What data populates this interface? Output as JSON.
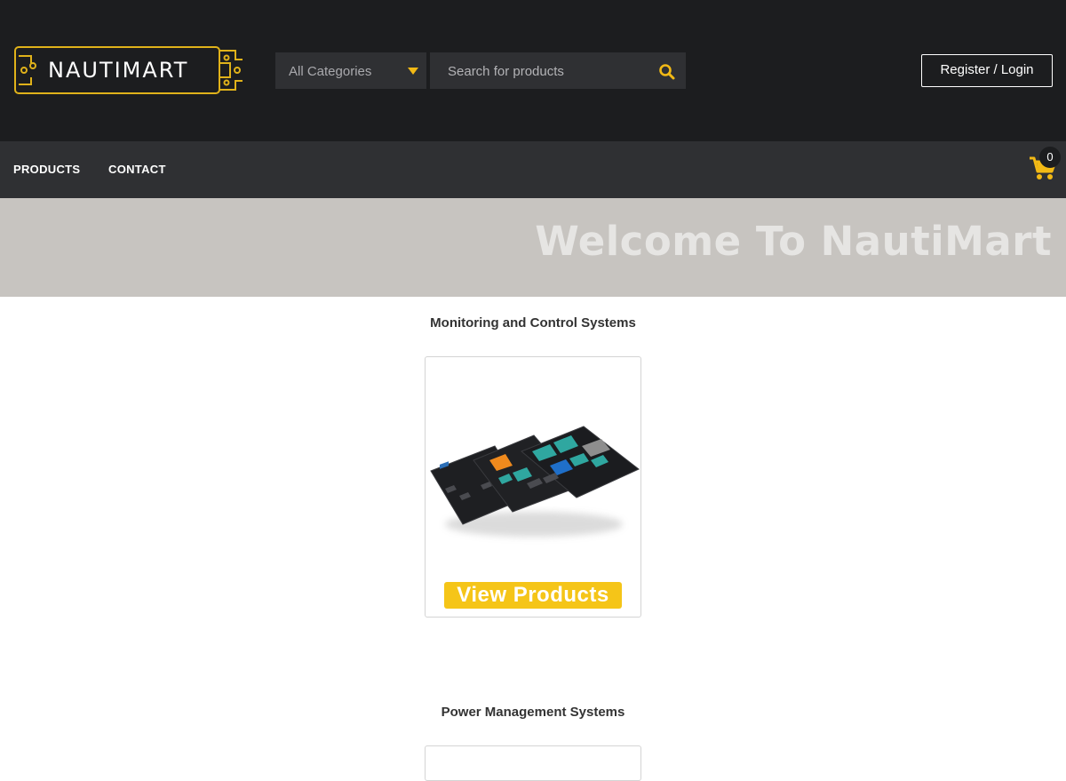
{
  "header": {
    "logo_text": "NAUTIMART",
    "category_select": {
      "selected": "All Categories"
    },
    "search": {
      "placeholder": "Search for products"
    },
    "login_label": "Register / Login"
  },
  "nav": {
    "items": [
      {
        "label": "PRODUCTS"
      },
      {
        "label": "CONTACT"
      }
    ],
    "cart_count": "0"
  },
  "hero": {
    "title": "Welcome To NautiMart"
  },
  "sections": [
    {
      "title": "Monitoring and Control Systems",
      "button_label": "View Products"
    },
    {
      "title": "Power Management Systems"
    }
  ],
  "colors": {
    "accent": "#f2b915",
    "header_bg": "#1c1d1f",
    "nav_bg": "#2f3033",
    "hero_bg": "#c7c4c0",
    "button_bg": "#f5c518"
  },
  "icons": {
    "search": "magnifier-icon",
    "cart": "shopping-cart-icon",
    "dropdown": "caret-down-icon"
  }
}
